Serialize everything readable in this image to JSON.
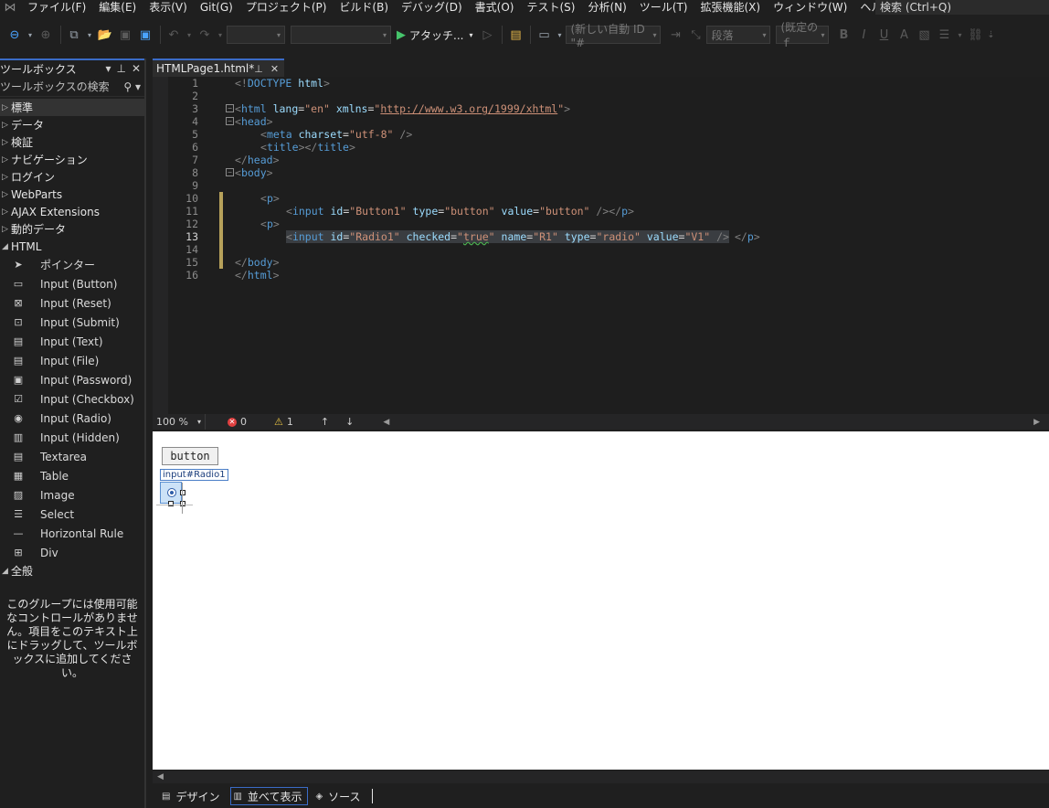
{
  "menu": {
    "items": [
      "ファイル(F)",
      "編集(E)",
      "表示(V)",
      "Git(G)",
      "プロジェクト(P)",
      "ビルド(B)",
      "デバッグ(D)",
      "書式(O)",
      "テスト(S)",
      "分析(N)",
      "ツール(T)",
      "拡張機能(X)",
      "ウィンドウ(W)",
      "ヘルプ(H)"
    ],
    "search_placeholder": "検索 (Ctrl+Q)"
  },
  "toolbar": {
    "attach_label": "アタッチ...",
    "block_format": "(新しい自動 ID \"#",
    "paragraph": "段落",
    "font_default": "(既定のｆ",
    "bold": "B",
    "italic": "I",
    "underline": "U"
  },
  "toolbox": {
    "title": "ツールボックス",
    "search_placeholder": "ツールボックスの検索",
    "groups_top": [
      {
        "label": "標準",
        "arrow": "▷",
        "selected": true
      },
      {
        "label": "データ",
        "arrow": "▷"
      },
      {
        "label": "検証",
        "arrow": "▷"
      },
      {
        "label": "ナビゲーション",
        "arrow": "▷"
      },
      {
        "label": "ログイン",
        "arrow": "▷"
      },
      {
        "label": "WebParts",
        "arrow": "▷"
      },
      {
        "label": "AJAX Extensions",
        "arrow": "▷"
      },
      {
        "label": "動的データ",
        "arrow": "▷"
      }
    ],
    "html_group": "HTML",
    "html_items": [
      {
        "label": "ポインター",
        "icon": "pointer-icon",
        "glyph": "➤"
      },
      {
        "label": "Input (Button)",
        "icon": "button-icon",
        "glyph": "▭"
      },
      {
        "label": "Input (Reset)",
        "icon": "reset-icon",
        "glyph": "⊠"
      },
      {
        "label": "Input (Submit)",
        "icon": "submit-icon",
        "glyph": "⊡"
      },
      {
        "label": "Input (Text)",
        "icon": "textbox-icon",
        "glyph": "▤"
      },
      {
        "label": "Input (File)",
        "icon": "file-icon",
        "glyph": "▤"
      },
      {
        "label": "Input (Password)",
        "icon": "password-icon",
        "glyph": "▣"
      },
      {
        "label": "Input (Checkbox)",
        "icon": "checkbox-icon",
        "glyph": "☑"
      },
      {
        "label": "Input (Radio)",
        "icon": "radio-icon",
        "glyph": "◉"
      },
      {
        "label": "Input (Hidden)",
        "icon": "hidden-icon",
        "glyph": "▥"
      },
      {
        "label": "Textarea",
        "icon": "textarea-icon",
        "glyph": "▤"
      },
      {
        "label": "Table",
        "icon": "table-icon",
        "glyph": "▦"
      },
      {
        "label": "Image",
        "icon": "image-icon",
        "glyph": "▨"
      },
      {
        "label": "Select",
        "icon": "select-icon",
        "glyph": "☰"
      },
      {
        "label": "Horizontal Rule",
        "icon": "hr-icon",
        "glyph": "—"
      },
      {
        "label": "Div",
        "icon": "div-icon",
        "glyph": "⊞"
      }
    ],
    "general_group": "全般",
    "empty_message": "このグループには使用可能なコントロールがありません。項目をこのテキスト上にドラッグして、ツールボックスに追加してください。"
  },
  "tab": {
    "name": "HTMLPage1.html*"
  },
  "editor": {
    "line_numbers": [
      "1",
      "2",
      "3",
      "4",
      "5",
      "6",
      "7",
      "8",
      "9",
      "10",
      "11",
      "12",
      "13",
      "14",
      "15",
      "16"
    ],
    "current_line": "13"
  },
  "status": {
    "zoom": "100 %",
    "errors": "0",
    "warnings": "1"
  },
  "design": {
    "button_value": "button",
    "selection_tag": "input#Radio1"
  },
  "viewtabs": {
    "design": "デザイン",
    "split": "並べて表示",
    "source": "ソース"
  },
  "colors": {
    "accent": "#3a6bc7",
    "background": "#1f1f1f",
    "editor_bg": "#1e1e1e",
    "tag": "#569cd6",
    "attr": "#9cdcfe",
    "value": "#ce9178"
  }
}
